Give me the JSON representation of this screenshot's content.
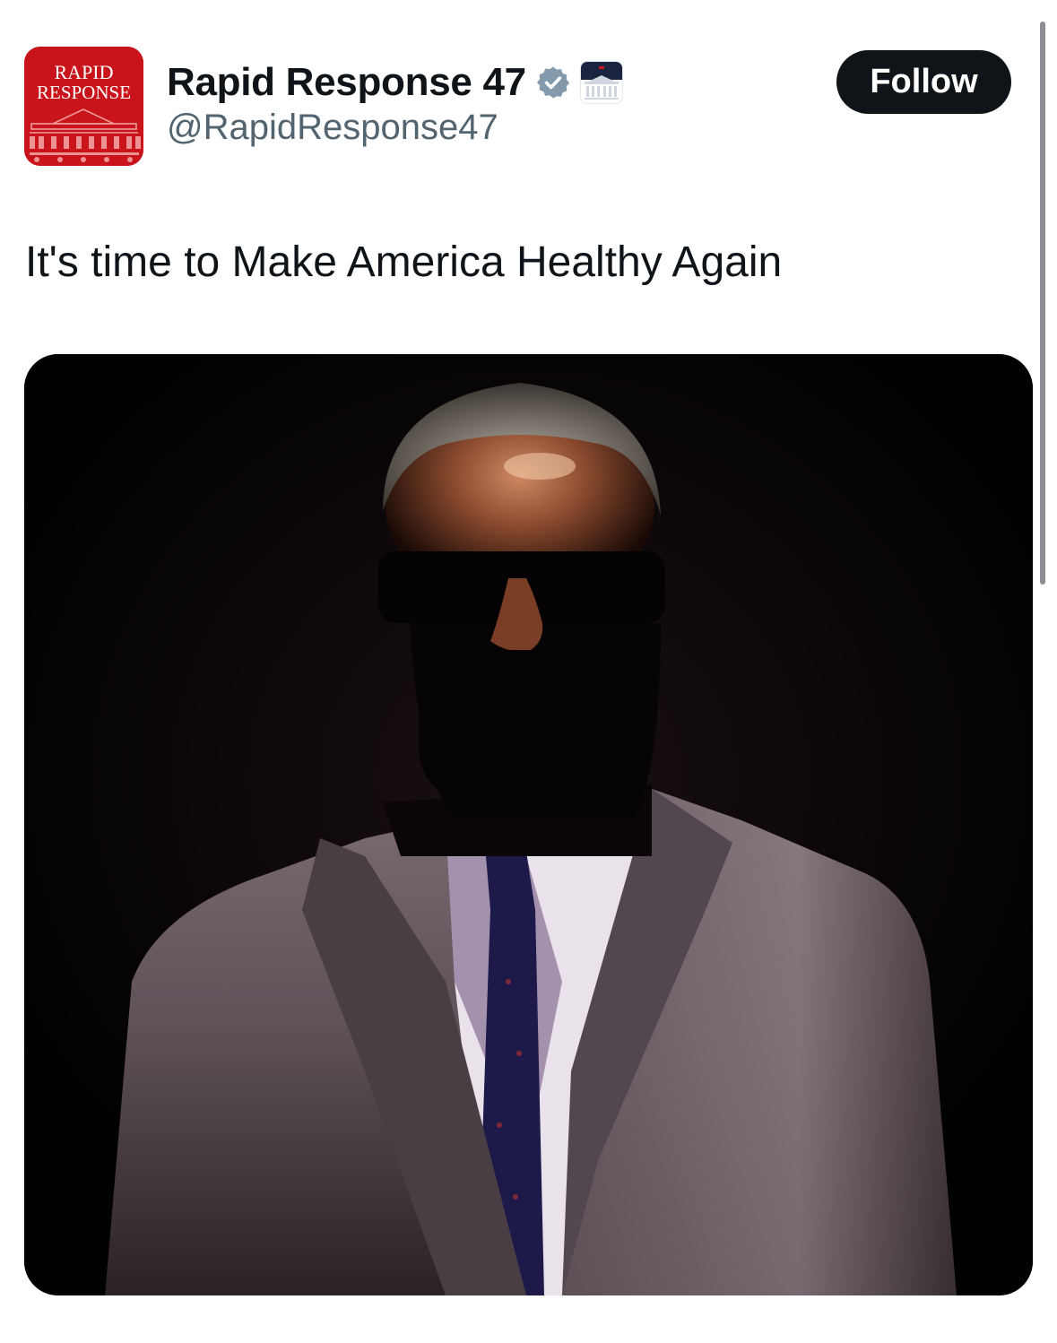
{
  "account": {
    "display_name": "Rapid Response 47",
    "handle": "@RapidResponse47",
    "avatar_text_line1": "RAPID",
    "avatar_text_line2": "RESPONSE",
    "verified_icon": "verified-badge-icon",
    "affiliate_icon": "white-house-affiliate-icon"
  },
  "actions": {
    "follow_label": "Follow"
  },
  "tweet": {
    "text": "It's time to Make America Healthy Again"
  },
  "media": {
    "kind": "photo",
    "icon": "portrait-photo"
  },
  "colors": {
    "avatar_bg": "#c8141a",
    "follow_bg": "#0f1419",
    "verified": "#829aab",
    "handle": "#536471"
  }
}
